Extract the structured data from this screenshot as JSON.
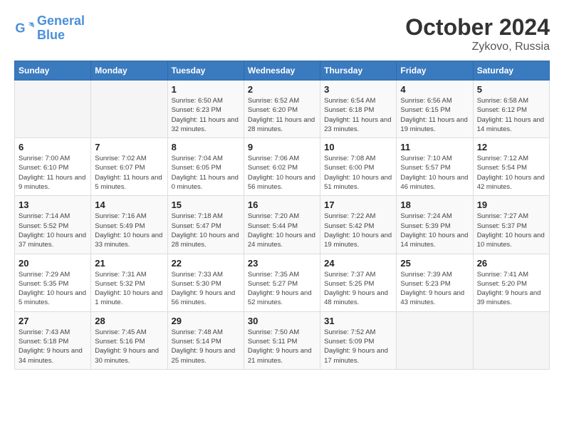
{
  "logo": {
    "line1": "General",
    "line2": "Blue"
  },
  "title": "October 2024",
  "subtitle": "Zykovo, Russia",
  "days_of_week": [
    "Sunday",
    "Monday",
    "Tuesday",
    "Wednesday",
    "Thursday",
    "Friday",
    "Saturday"
  ],
  "weeks": [
    [
      {
        "day": "",
        "info": ""
      },
      {
        "day": "",
        "info": ""
      },
      {
        "day": "1",
        "info": "Sunrise: 6:50 AM\nSunset: 6:23 PM\nDaylight: 11 hours and 32 minutes."
      },
      {
        "day": "2",
        "info": "Sunrise: 6:52 AM\nSunset: 6:20 PM\nDaylight: 11 hours and 28 minutes."
      },
      {
        "day": "3",
        "info": "Sunrise: 6:54 AM\nSunset: 6:18 PM\nDaylight: 11 hours and 23 minutes."
      },
      {
        "day": "4",
        "info": "Sunrise: 6:56 AM\nSunset: 6:15 PM\nDaylight: 11 hours and 19 minutes."
      },
      {
        "day": "5",
        "info": "Sunrise: 6:58 AM\nSunset: 6:12 PM\nDaylight: 11 hours and 14 minutes."
      }
    ],
    [
      {
        "day": "6",
        "info": "Sunrise: 7:00 AM\nSunset: 6:10 PM\nDaylight: 11 hours and 9 minutes."
      },
      {
        "day": "7",
        "info": "Sunrise: 7:02 AM\nSunset: 6:07 PM\nDaylight: 11 hours and 5 minutes."
      },
      {
        "day": "8",
        "info": "Sunrise: 7:04 AM\nSunset: 6:05 PM\nDaylight: 11 hours and 0 minutes."
      },
      {
        "day": "9",
        "info": "Sunrise: 7:06 AM\nSunset: 6:02 PM\nDaylight: 10 hours and 56 minutes."
      },
      {
        "day": "10",
        "info": "Sunrise: 7:08 AM\nSunset: 6:00 PM\nDaylight: 10 hours and 51 minutes."
      },
      {
        "day": "11",
        "info": "Sunrise: 7:10 AM\nSunset: 5:57 PM\nDaylight: 10 hours and 46 minutes."
      },
      {
        "day": "12",
        "info": "Sunrise: 7:12 AM\nSunset: 5:54 PM\nDaylight: 10 hours and 42 minutes."
      }
    ],
    [
      {
        "day": "13",
        "info": "Sunrise: 7:14 AM\nSunset: 5:52 PM\nDaylight: 10 hours and 37 minutes."
      },
      {
        "day": "14",
        "info": "Sunrise: 7:16 AM\nSunset: 5:49 PM\nDaylight: 10 hours and 33 minutes."
      },
      {
        "day": "15",
        "info": "Sunrise: 7:18 AM\nSunset: 5:47 PM\nDaylight: 10 hours and 28 minutes."
      },
      {
        "day": "16",
        "info": "Sunrise: 7:20 AM\nSunset: 5:44 PM\nDaylight: 10 hours and 24 minutes."
      },
      {
        "day": "17",
        "info": "Sunrise: 7:22 AM\nSunset: 5:42 PM\nDaylight: 10 hours and 19 minutes."
      },
      {
        "day": "18",
        "info": "Sunrise: 7:24 AM\nSunset: 5:39 PM\nDaylight: 10 hours and 14 minutes."
      },
      {
        "day": "19",
        "info": "Sunrise: 7:27 AM\nSunset: 5:37 PM\nDaylight: 10 hours and 10 minutes."
      }
    ],
    [
      {
        "day": "20",
        "info": "Sunrise: 7:29 AM\nSunset: 5:35 PM\nDaylight: 10 hours and 5 minutes."
      },
      {
        "day": "21",
        "info": "Sunrise: 7:31 AM\nSunset: 5:32 PM\nDaylight: 10 hours and 1 minute."
      },
      {
        "day": "22",
        "info": "Sunrise: 7:33 AM\nSunset: 5:30 PM\nDaylight: 9 hours and 56 minutes."
      },
      {
        "day": "23",
        "info": "Sunrise: 7:35 AM\nSunset: 5:27 PM\nDaylight: 9 hours and 52 minutes."
      },
      {
        "day": "24",
        "info": "Sunrise: 7:37 AM\nSunset: 5:25 PM\nDaylight: 9 hours and 48 minutes."
      },
      {
        "day": "25",
        "info": "Sunrise: 7:39 AM\nSunset: 5:23 PM\nDaylight: 9 hours and 43 minutes."
      },
      {
        "day": "26",
        "info": "Sunrise: 7:41 AM\nSunset: 5:20 PM\nDaylight: 9 hours and 39 minutes."
      }
    ],
    [
      {
        "day": "27",
        "info": "Sunrise: 7:43 AM\nSunset: 5:18 PM\nDaylight: 9 hours and 34 minutes."
      },
      {
        "day": "28",
        "info": "Sunrise: 7:45 AM\nSunset: 5:16 PM\nDaylight: 9 hours and 30 minutes."
      },
      {
        "day": "29",
        "info": "Sunrise: 7:48 AM\nSunset: 5:14 PM\nDaylight: 9 hours and 25 minutes."
      },
      {
        "day": "30",
        "info": "Sunrise: 7:50 AM\nSunset: 5:11 PM\nDaylight: 9 hours and 21 minutes."
      },
      {
        "day": "31",
        "info": "Sunrise: 7:52 AM\nSunset: 5:09 PM\nDaylight: 9 hours and 17 minutes."
      },
      {
        "day": "",
        "info": ""
      },
      {
        "day": "",
        "info": ""
      }
    ]
  ]
}
